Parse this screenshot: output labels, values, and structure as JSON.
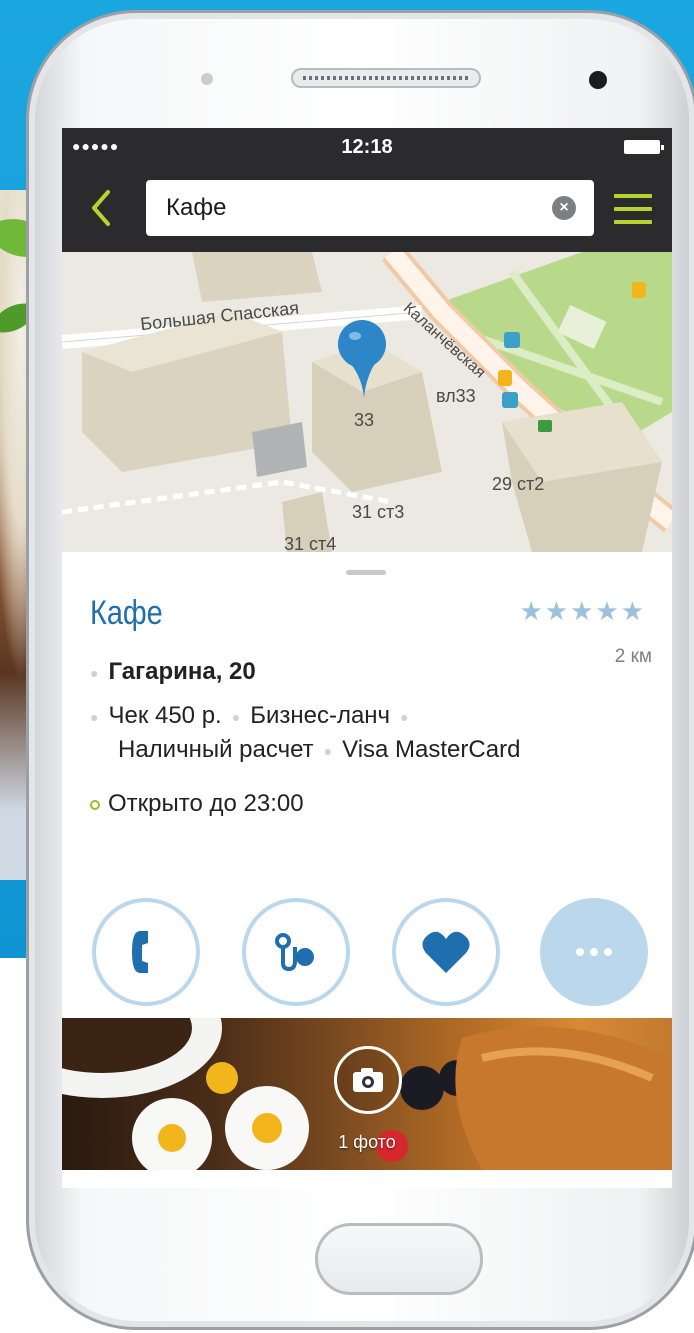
{
  "status_bar": {
    "signal": "●●●●●",
    "time": "12:18",
    "battery_icon": "battery-icon"
  },
  "nav": {
    "back_icon": "chevron-left-icon",
    "search_value": "Кафе",
    "clear_icon": "clear-circle-icon",
    "menu_icon": "hamburger-menu-icon",
    "accent_color": "#b7d332"
  },
  "map": {
    "street_1": "Большая Спасская",
    "street_2": "Каланчёвская",
    "buildings": [
      "33",
      "вл33",
      "29 ст2",
      "31 ст3",
      "31 ст4"
    ],
    "pin_icon": "map-pin-icon",
    "poi_icons": [
      "tram-icon",
      "bus-icon",
      "bus-icon",
      "bus-icon",
      "metro-icon"
    ]
  },
  "place": {
    "title": "Кафе",
    "rating_text": "★★★★★",
    "rating": 4.5,
    "rating_max": 5,
    "distance": "2 км",
    "address": "Гагарина, 20",
    "features_line1": [
      "Чек 450 р.",
      "Бизнес-ланч"
    ],
    "features_line2": [
      "Наличный расчет",
      "Visa MasterCard"
    ],
    "hours": "Открыто до 23:00",
    "title_color": "#1f6fae"
  },
  "actions": [
    {
      "name": "call",
      "icon": "phone-icon"
    },
    {
      "name": "route",
      "icon": "route-icon"
    },
    {
      "name": "favorite",
      "icon": "heart-icon"
    },
    {
      "name": "more",
      "icon": "more-dots-icon"
    }
  ],
  "photos": {
    "label": "1 фото",
    "icon": "camera-icon"
  }
}
